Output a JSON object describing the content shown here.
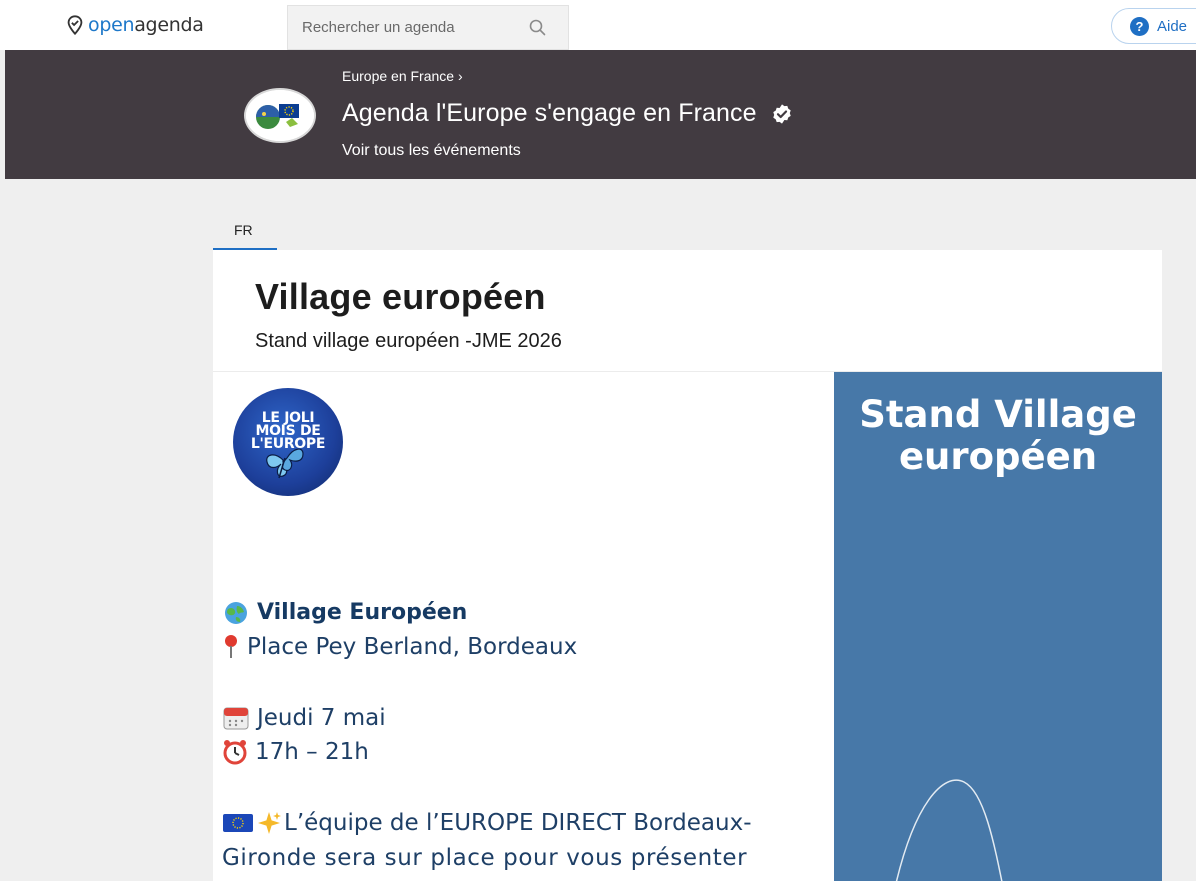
{
  "topnav": {
    "logo_open": "open",
    "logo_agenda": "agenda",
    "search_placeholder": "Rechercher un agenda",
    "help_label": "Aide",
    "help_icon": "?",
    "accent_color": "#1f6fc4"
  },
  "agenda": {
    "breadcrumb": "Europe en France ›",
    "title": "Agenda l'Europe s'engage en France",
    "see_all": "Voir tous les événements",
    "header_bg": "#423b41"
  },
  "tabs": [
    {
      "label": "FR",
      "active": true
    }
  ],
  "event": {
    "title": "Village européen",
    "subtitle": "Stand village européen -JME 2026"
  },
  "poster": {
    "side_title_line1": "Stand Village",
    "side_title_line2": "européen",
    "side_bg": "#4778a8",
    "badge_lines": [
      "LE JOLI",
      "MOIS DE",
      "L'EUROPE"
    ],
    "village_name": "Village Européen",
    "place": "Place Pey Berland, Bordeaux",
    "day": "Jeudi 7 mai",
    "hours": "17h – 21h",
    "desc_line1": "L’équipe de l’EUROPE DIRECT Bordeaux-",
    "desc_line2": "Gironde sera sur place pour vous présenter"
  }
}
